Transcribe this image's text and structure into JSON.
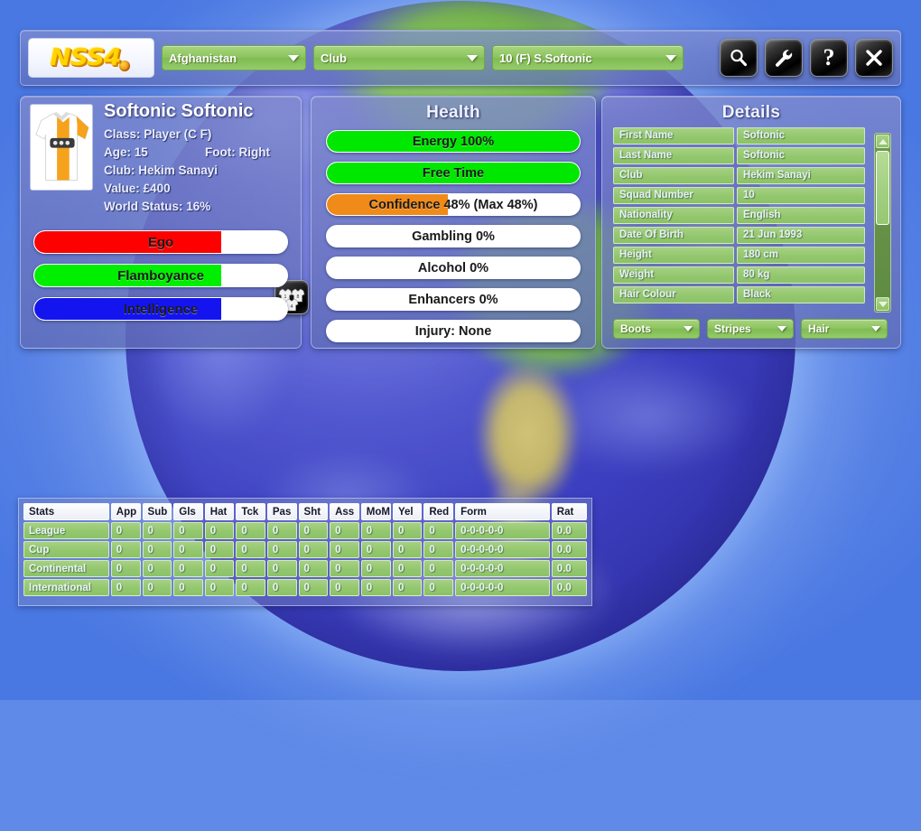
{
  "app": {
    "logo_text": "NSS4",
    "logo_icon": "football-icon"
  },
  "topbar": {
    "country_dropdown": "Afghanistan",
    "type_dropdown": "Club",
    "player_dropdown": "10 (F) S.Softonic",
    "buttons": [
      {
        "name": "search-button",
        "icon": "magnifier-icon"
      },
      {
        "name": "tools-button",
        "icon": "wrench-icon"
      },
      {
        "name": "help-button",
        "icon": "question-mark-icon"
      },
      {
        "name": "close-button",
        "icon": "close-x-icon"
      }
    ]
  },
  "player": {
    "name": "Softonic Softonic",
    "class_label": "Class:",
    "class_value": "Player (C F)",
    "age_label": "Age:",
    "age_value": "15",
    "foot_label": "Foot:",
    "foot_value": "Right",
    "club_label": "Club:",
    "club_value": "Hekim Sanayi",
    "value_label": "Value:",
    "value_value": "£400",
    "status_label": "World Status:",
    "status_value": "16%",
    "kit_button_icon": "kit-shirts-icon",
    "traits": [
      {
        "label": "Ego",
        "percent": 74,
        "color": "#ff0000"
      },
      {
        "label": "Flamboyance",
        "percent": 74,
        "color": "#00ee00"
      },
      {
        "label": "Intelligence",
        "percent": 74,
        "color": "#1414ee"
      }
    ]
  },
  "health": {
    "title": "Health",
    "bars": [
      {
        "label": "Energy 100%",
        "percent": 100,
        "color": "#00e800"
      },
      {
        "label": "Free Time",
        "percent": 100,
        "color": "#00e800"
      },
      {
        "label": "Confidence 48% (Max 48%)",
        "percent": 48,
        "color": "#f08a18"
      },
      {
        "label": "Gambling 0%",
        "percent": 0,
        "color": "#cccccc"
      },
      {
        "label": "Alcohol 0%",
        "percent": 0,
        "color": "#cccccc"
      },
      {
        "label": "Enhancers 0%",
        "percent": 0,
        "color": "#cccccc"
      },
      {
        "label": "Injury: None",
        "percent": 0,
        "color": "#cccccc"
      }
    ]
  },
  "details": {
    "title": "Details",
    "rows": [
      {
        "key": "First Name",
        "value": "Softonic"
      },
      {
        "key": "Last Name",
        "value": "Softonic"
      },
      {
        "key": "Club",
        "value": "Hekim Sanayi"
      },
      {
        "key": "Squad Number",
        "value": "10"
      },
      {
        "key": "Nationality",
        "value": "English"
      },
      {
        "key": "Date Of Birth",
        "value": "21 Jun 1993"
      },
      {
        "key": "Height",
        "value": "180 cm"
      },
      {
        "key": "Weight",
        "value": "80 kg"
      },
      {
        "key": "Hair Colour",
        "value": "Black"
      }
    ],
    "dropdowns": [
      "Boots",
      "Stripes",
      "Hair"
    ]
  },
  "stats": {
    "columns": [
      "Stats",
      "App",
      "Sub",
      "Gls",
      "Hat",
      "Tck",
      "Pas",
      "Sht",
      "Ass",
      "MoM",
      "Yel",
      "Red",
      "Form",
      "Rat"
    ],
    "rows": [
      {
        "cells": [
          "League",
          "0",
          "0",
          "0",
          "0",
          "0",
          "0",
          "0",
          "0",
          "0",
          "0",
          "0",
          "0-0-0-0-0",
          "0.0"
        ]
      },
      {
        "cells": [
          "Cup",
          "0",
          "0",
          "0",
          "0",
          "0",
          "0",
          "0",
          "0",
          "0",
          "0",
          "0",
          "0-0-0-0-0",
          "0.0"
        ]
      },
      {
        "cells": [
          "Continental",
          "0",
          "0",
          "0",
          "0",
          "0",
          "0",
          "0",
          "0",
          "0",
          "0",
          "0",
          "0-0-0-0-0",
          "0.0"
        ]
      },
      {
        "cells": [
          "International",
          "0",
          "0",
          "0",
          "0",
          "0",
          "0",
          "0",
          "0",
          "0",
          "0",
          "0",
          "0-0-0-0-0",
          "0.0"
        ]
      }
    ]
  },
  "colors": {
    "panel": "#6c76c0",
    "dropdown_green": "#8cc45f",
    "row_green": "#93c76e",
    "accent_orange": "#f08a18"
  }
}
